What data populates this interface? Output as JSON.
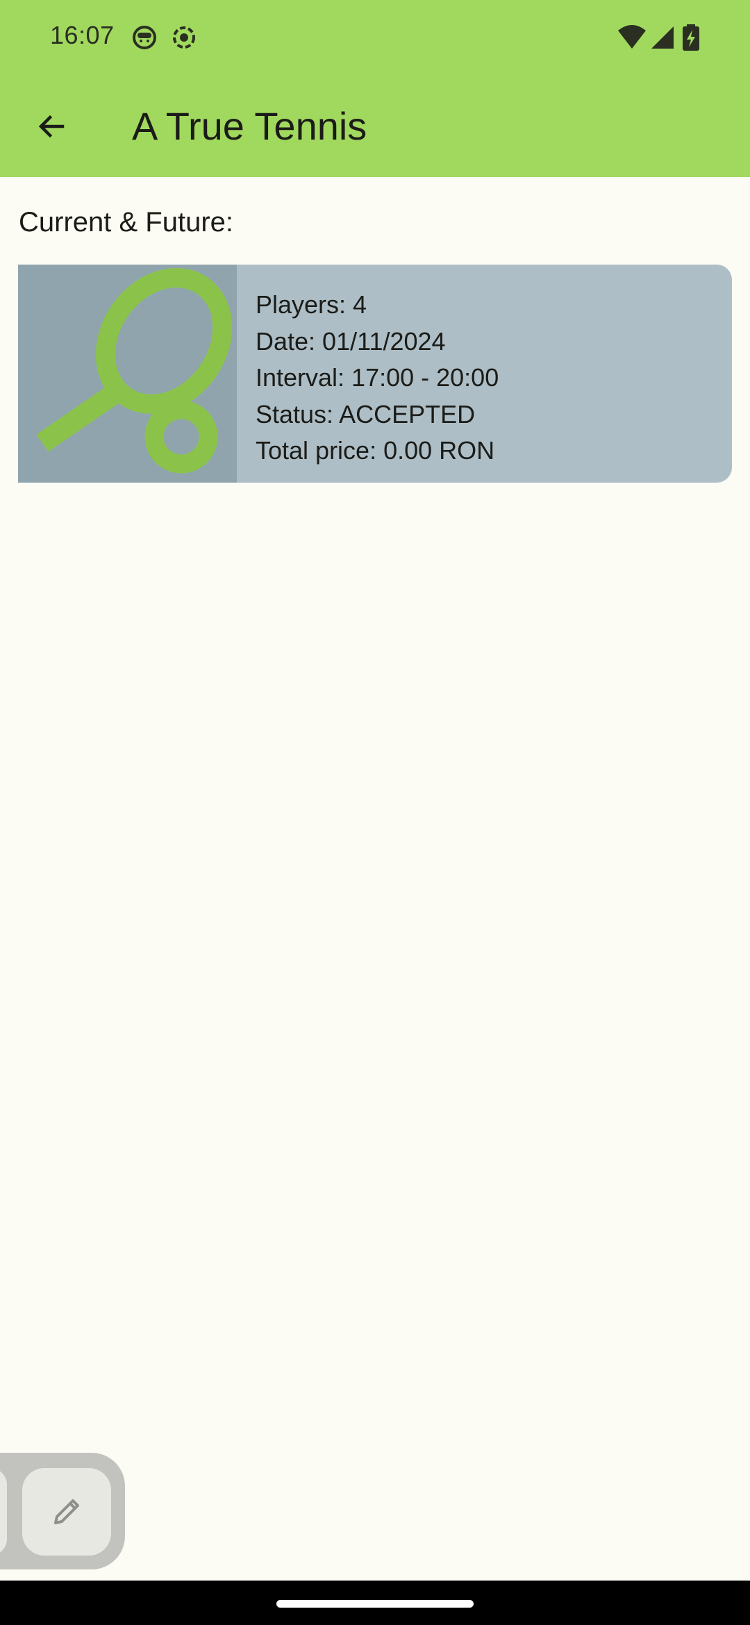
{
  "status_bar": {
    "time": "16:07",
    "left_icons": [
      "face-notification-icon",
      "record-notification-icon"
    ],
    "right_icons": [
      "wifi-icon",
      "cell-signal-icon",
      "battery-charging-icon"
    ]
  },
  "app_bar": {
    "back_icon": "arrow-back-icon",
    "title": "A True Tennis"
  },
  "section": {
    "title": "Current & Future:"
  },
  "booking": {
    "image_icon": "tennis-racket-ball-icon",
    "players": "Players: 4",
    "date": "Date: 01/11/2024",
    "interval": "Interval: 17:00 - 20:00",
    "status": "Status: ACCEPTED",
    "total_price": "Total price: 0.00 RON"
  },
  "fab": {
    "icon": "edit-pencil-icon"
  },
  "colors": {
    "header": "#A1D95E",
    "background": "#FCFCF4",
    "card": "#AEBEC6",
    "card_image": "#90A4AE",
    "racket": "#8BC34A"
  }
}
